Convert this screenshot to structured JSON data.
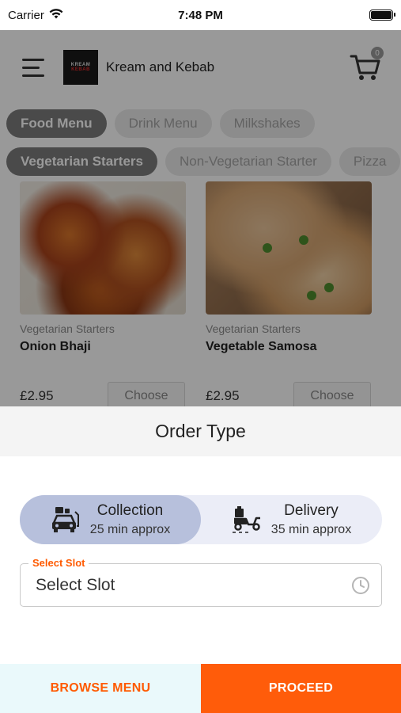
{
  "status_bar": {
    "carrier": "Carrier",
    "time": "7:48 PM",
    "icons": [
      "wifi-icon",
      "battery-icon"
    ]
  },
  "header": {
    "restaurant_name": "Kream and Kebab",
    "logo_text_top": "KREAM",
    "logo_text_bottom": "KEBAB",
    "cart_count": "0",
    "icons": [
      "menu-icon",
      "cart-icon"
    ]
  },
  "menu_tabs": [
    {
      "label": "Food Menu",
      "active": true
    },
    {
      "label": "Drink Menu",
      "active": false
    },
    {
      "label": "Milkshakes",
      "active": false
    }
  ],
  "category_tabs": [
    {
      "label": "Vegetarian Starters",
      "active": true
    },
    {
      "label": "Non-Vegetarian Starter",
      "active": false
    },
    {
      "label": "Pizza",
      "active": false
    }
  ],
  "products": [
    {
      "category": "Vegetarian Starters",
      "name": "Onion Bhaji",
      "price": "£2.95",
      "button": "Choose"
    },
    {
      "category": "Vegetarian Starters",
      "name": "Vegetable Samosa",
      "price": "£2.95",
      "button": "Choose"
    }
  ],
  "order_sheet": {
    "title": "Order Type",
    "options": [
      {
        "label": "Collection",
        "sub": "25 min approx",
        "selected": true,
        "icon": "collection-car-icon"
      },
      {
        "label": "Delivery",
        "sub": "35 min approx",
        "selected": false,
        "icon": "delivery-scooter-icon"
      }
    ],
    "slot": {
      "label": "Select Slot",
      "value": "Select Slot",
      "icon": "clock-icon"
    },
    "browse_label": "BROWSE MENU",
    "proceed_label": "PROCEED"
  },
  "colors": {
    "accent": "#ff5c0a",
    "selected_option": "#b7c0dc",
    "toggle_bg": "#ebedf7",
    "browse_bg": "#eaf9fb"
  }
}
